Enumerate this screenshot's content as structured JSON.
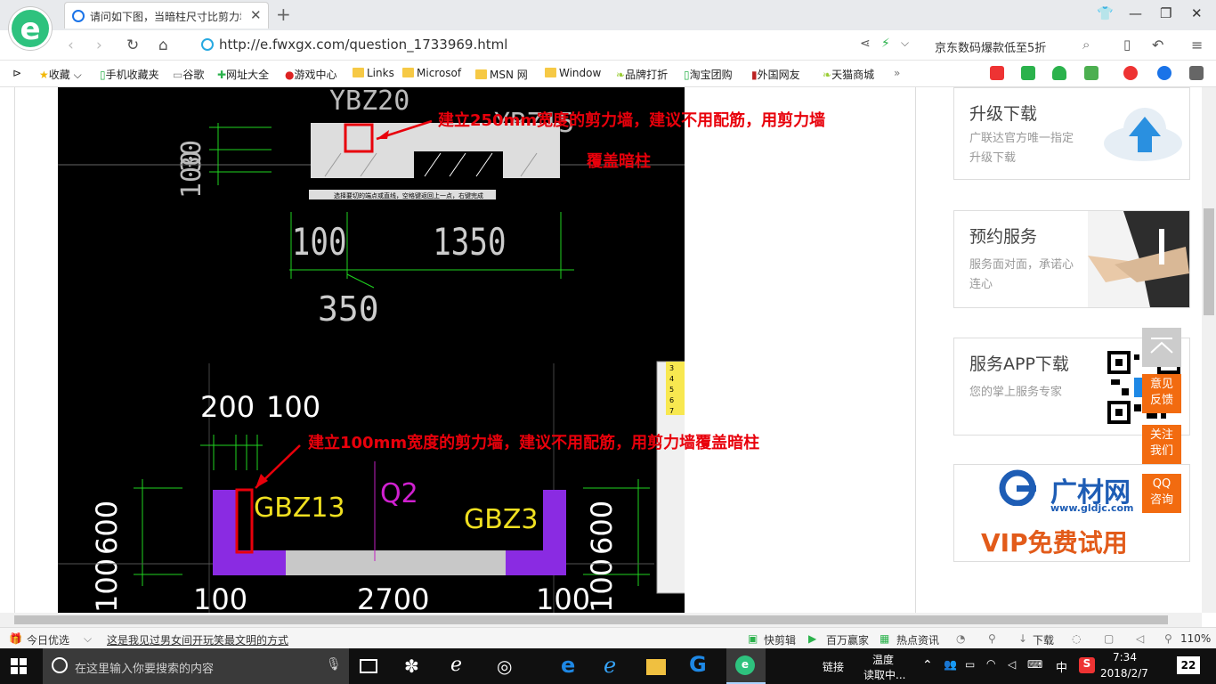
{
  "browser": {
    "tab_title": "请问如下图，当暗柱尺寸比剪力墙",
    "url": "http://e.fwxgx.com/question_1733969.html",
    "search_text": "京东数码爆款低至5折",
    "bookmarks": [
      "收藏",
      "手机收藏夹",
      "谷歌",
      "网址大全",
      "游戏中心",
      "Links",
      "Microsof",
      "MSN 网",
      "Window",
      "品牌打折",
      "淘宝团购",
      "外国网友",
      "天猫商城"
    ]
  },
  "cad": {
    "top_dims": [
      "YBZ20",
      "YBZ15",
      "100",
      "30",
      "100",
      "1350",
      "350"
    ],
    "status_strip": "选择要切的端点或直线，空格键返回上一点，右键完成",
    "bottom_dims": [
      "200",
      "100",
      "100",
      "600",
      "600",
      "100",
      "100",
      "2700",
      "100"
    ],
    "labels": {
      "gbz13": "GBZ13",
      "gbz3": "GBZ3",
      "q2": "Q2"
    },
    "list_numbers": [
      "3",
      "4",
      "5",
      "6",
      "7"
    ]
  },
  "annotations": {
    "top_line1": "建立250mm宽度的剪力墙，建议不用配筋，用剪力墙",
    "top_line2": "覆盖暗柱",
    "bottom": "建立100mm宽度的剪力墙，建议不用配筋，用剪力墙覆盖暗柱"
  },
  "sidebar": {
    "cards": [
      {
        "title": "升级下载",
        "sub": "广联达官方唯一指定升级下载"
      },
      {
        "title": "预约服务",
        "sub": "服务面对面，承诺心连心"
      },
      {
        "title": "服务APP下载",
        "sub": "您的掌上服务专家"
      }
    ],
    "ad_brand": "广材网",
    "ad_url": "www.gldjc.com",
    "ad_vip": "VIP免费试用",
    "float_buttons": [
      "意见反馈",
      "关注我们",
      "QQ咨询"
    ]
  },
  "statusbar": {
    "left": [
      "今日优选",
      "这是我见过男女间开玩笑最文明的方式"
    ],
    "right": [
      "快剪辑",
      "百万赢家",
      "热点资讯",
      "下载",
      "110%"
    ]
  },
  "taskbar": {
    "search_placeholder": "在这里输入你要搜索的内容",
    "tray": [
      "链接",
      "温度",
      "读取中...",
      "中",
      "7:34",
      "2018/2/7",
      "22"
    ]
  },
  "colors": {
    "annotation_red": "#e8000b",
    "wall_purple": "#8a2be2",
    "dim_green": "#1fd51f",
    "label_yellow": "#f0e020",
    "accent_orange": "#f26b10"
  }
}
